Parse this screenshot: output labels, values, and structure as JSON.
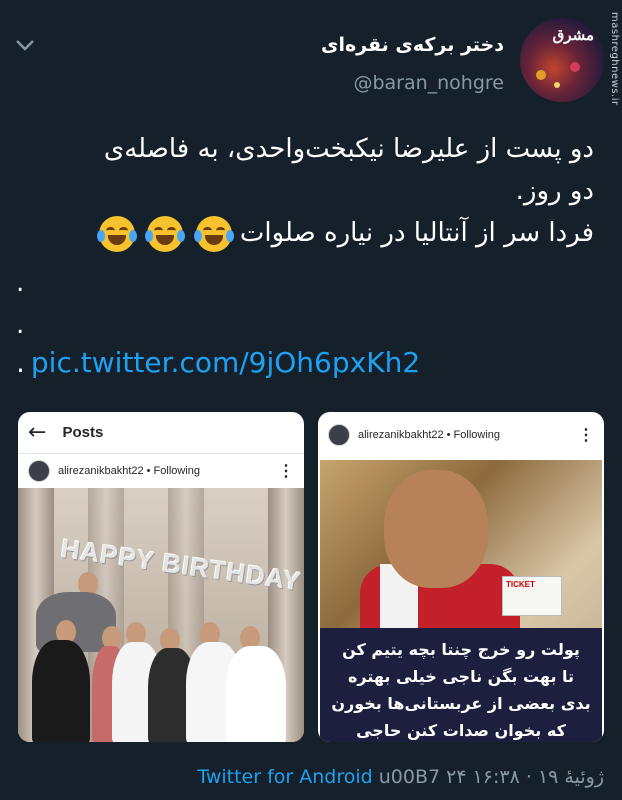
{
  "tweet": {
    "display_name": "دختر برکه‌ی نقره‌ای",
    "handle": "@baran_nohgre",
    "text_line1": "دو پست از علیرضا نیکبخت‌واحدی، به فاصله‌ی",
    "text_line2": "دو روز.",
    "text_line3": "فردا سر از آنتالیا در نیاره صلوات",
    "dot1": ".",
    "dot2": ".",
    "dot3": ".",
    "link": "pic.twitter.com/9jOh6pxKh2",
    "emoji_icon": "face-with-tears-of-joy-icon"
  },
  "avatar": {
    "logo_text": "مشرق",
    "watermark": "mashreghnews.ir"
  },
  "left_card": {
    "header_title": "Posts",
    "username": "alirezanikbakht22",
    "follow_status": "• Following",
    "balloon_text": "HAPPY BIRTHDAY"
  },
  "right_card": {
    "username": "alirezanikbakht22",
    "follow_status": "• Following",
    "ticket_label": "TICKET",
    "caption_line1": "پولت رو خرج چنتا بچه یتیم کن",
    "caption_line2": "تا بهت بگن ناجی خیلی بهتره",
    "caption_line3": "بدی بعضی از عربستانی‌ها بخورن",
    "caption_line4": "که بخوان صدات کنن حاجی"
  },
  "footer": {
    "time": "۱۶:۳۸",
    "separator": "·",
    "date": "۲۴ ژوئیهٔ ۱۹",
    "via": "u00B7",
    "source": "Twitter for Android"
  },
  "colors": {
    "background": "#15202b",
    "link": "#1da1f2",
    "secondary_text": "#8899a6"
  }
}
